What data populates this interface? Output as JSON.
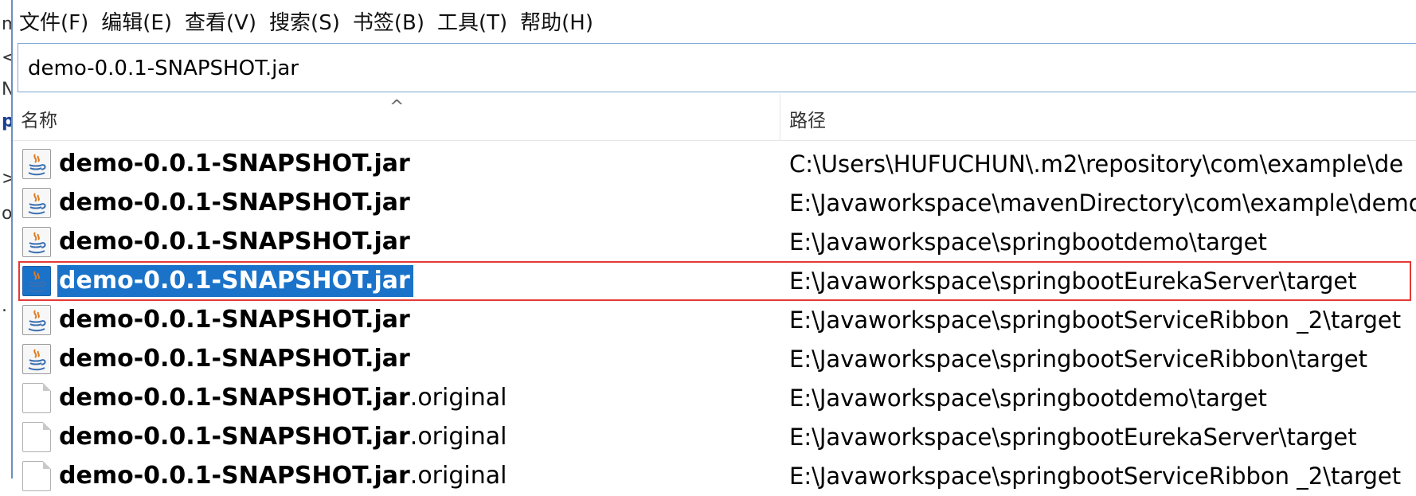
{
  "menu": [
    {
      "label": "文件(F)"
    },
    {
      "label": "编辑(E)"
    },
    {
      "label": "查看(V)"
    },
    {
      "label": "搜索(S)"
    },
    {
      "label": "书签(B)"
    },
    {
      "label": "工具(T)"
    },
    {
      "label": "帮助(H)"
    }
  ],
  "search": {
    "value": "demo-0.0.1-SNAPSHOT.jar"
  },
  "columns": {
    "name": "名称",
    "sort_indicator": "^",
    "path": "路径"
  },
  "rows": [
    {
      "name": "demo-0.0.1-SNAPSHOT.jar",
      "ext": "",
      "path": "C:\\Users\\HUFUCHUN\\.m2\\repository\\com\\example\\de",
      "icon": "java-jar-icon"
    },
    {
      "name": "demo-0.0.1-SNAPSHOT.jar",
      "ext": "",
      "path": "E:\\Javaworkspace\\mavenDirectory\\com\\example\\demo",
      "icon": "java-jar-icon"
    },
    {
      "name": "demo-0.0.1-SNAPSHOT.jar",
      "ext": "",
      "path": "E:\\Javaworkspace\\springbootdemo\\target",
      "icon": "java-jar-icon"
    },
    {
      "name": "demo-0.0.1-SNAPSHOT.jar",
      "ext": "",
      "path": "E:\\Javaworkspace\\springbootEurekaServer\\target",
      "icon": "java-jar-icon",
      "selected": true
    },
    {
      "name": "demo-0.0.1-SNAPSHOT.jar",
      "ext": "",
      "path": "E:\\Javaworkspace\\springbootServiceRibbon _2\\target",
      "icon": "java-jar-icon"
    },
    {
      "name": "demo-0.0.1-SNAPSHOT.jar",
      "ext": "",
      "path": "E:\\Javaworkspace\\springbootServiceRibbon\\target",
      "icon": "java-jar-icon"
    },
    {
      "name": "demo-0.0.1-SNAPSHOT.jar",
      "ext": ".original",
      "path": "E:\\Javaworkspace\\springbootdemo\\target",
      "icon": "blank-file-icon"
    },
    {
      "name": "demo-0.0.1-SNAPSHOT.jar",
      "ext": ".original",
      "path": "E:\\Javaworkspace\\springbootEurekaServer\\target",
      "icon": "blank-file-icon"
    },
    {
      "name": "demo-0.0.1-SNAPSHOT.jar",
      "ext": ".original",
      "path": "E:\\Javaworkspace\\springbootServiceRibbon _2\\target",
      "icon": "blank-file-icon"
    }
  ],
  "colors": {
    "selection": "#1a73c9",
    "highlight_border": "#e53935"
  }
}
